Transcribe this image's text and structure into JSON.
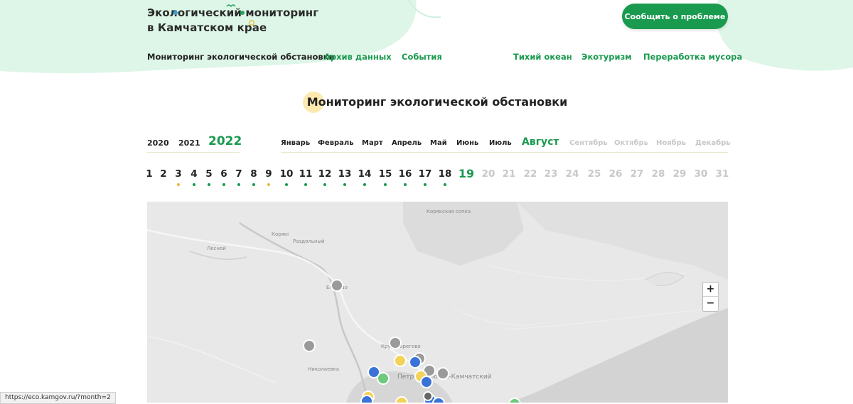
{
  "header": {
    "site_title_line1": "Экологический мониторинг",
    "site_title_line2": "в Камчатском крае",
    "report_button": "Сообщить о проблеме",
    "nav_left": [
      "Мониторинг экологической обстановки",
      "Архив данных",
      "События"
    ],
    "nav_right": [
      "Тихий океан",
      "Экотуризм",
      "Переработка мусора"
    ],
    "active_nav": "Мониторинг экологической обстановки"
  },
  "page": {
    "title": "Мониторинг экологической обстановки"
  },
  "years": {
    "items": [
      "2020",
      "2021",
      "2022"
    ],
    "active": "2022"
  },
  "months": {
    "items": [
      "Январь",
      "Февраль",
      "Март",
      "Апрель",
      "Май",
      "Июнь",
      "Июль",
      "Август",
      "Сентябрь",
      "Октябрь",
      "Ноябрь",
      "Декабрь"
    ],
    "active": "Август",
    "disabled": [
      "Сентябрь",
      "Октябрь",
      "Ноябрь",
      "Декабрь"
    ]
  },
  "days": {
    "items": [
      "1",
      "2",
      "3",
      "4",
      "5",
      "6",
      "7",
      "8",
      "9",
      "10",
      "11",
      "12",
      "13",
      "14",
      "15",
      "16",
      "17",
      "18",
      "19",
      "20",
      "21",
      "22",
      "23",
      "24",
      "25",
      "26",
      "27",
      "28",
      "29",
      "30",
      "31"
    ],
    "active": "19",
    "first_disabled": 20,
    "yellow_dots": [
      "3",
      "9"
    ],
    "green_dots": [
      "4",
      "5",
      "6",
      "7",
      "8",
      "10",
      "11",
      "12",
      "13",
      "14",
      "15",
      "16",
      "17",
      "18"
    ]
  },
  "map": {
    "labels": [
      "Корякская сопка",
      "Корякі",
      "Раздольный",
      "Лесной",
      "Елизово",
      "Крутоберегово",
      "Николаевка",
      "Петропавловск-Камчатский"
    ],
    "zoom_in": "+",
    "zoom_out": "−"
  },
  "status_bar": {
    "url": "https://eco.kamgov.ru/?month=2"
  },
  "colors": {
    "brand_green": "#1a9a4f",
    "map_bg": "#e6e6e6",
    "marker_yellow": "#f3d25a",
    "marker_blue": "#3a73d8",
    "marker_grey": "#9a9a9a"
  }
}
